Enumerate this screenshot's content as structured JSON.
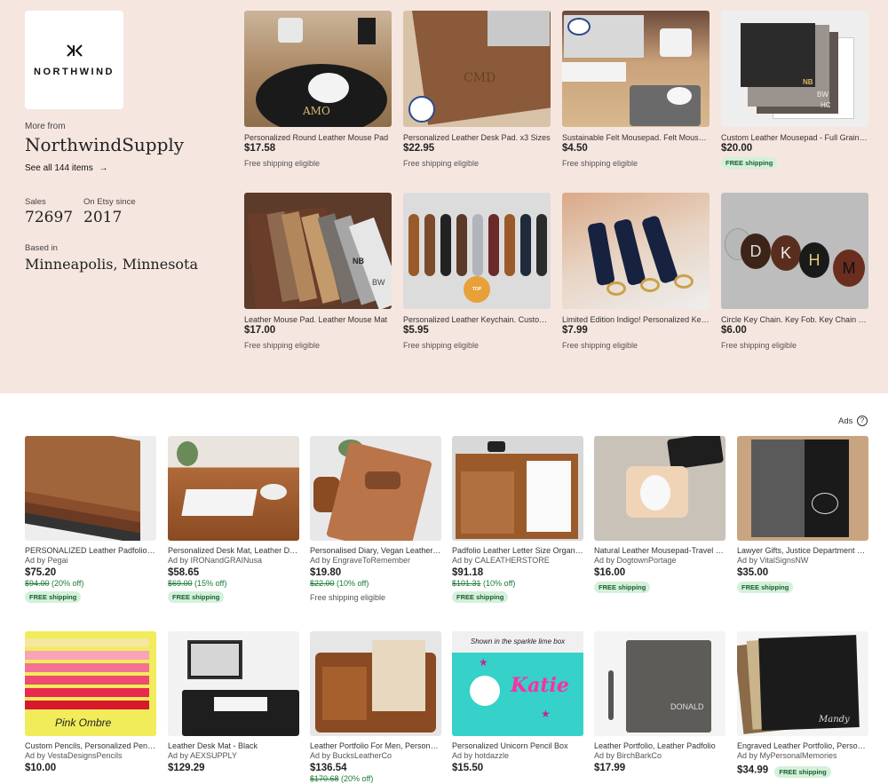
{
  "shop": {
    "logo_text": "NORTHWIND",
    "more_from": "More from",
    "name": "NorthwindSupply",
    "see_all": "See all 144 items",
    "sales_label": "Sales",
    "sales_value": "72697",
    "since_label": "On Etsy since",
    "since_value": "2017",
    "based_label": "Based in",
    "location": "Minneapolis, Minnesota"
  },
  "shop_items": [
    {
      "title": "Personalized Round Leather Mouse Pad",
      "price": "$17.58",
      "shipping": "Free shipping eligible",
      "badge": ""
    },
    {
      "title": "Personalized Leather Desk Pad. x3 Sizes",
      "price": "$22.95",
      "shipping": "Free shipping eligible",
      "badge": ""
    },
    {
      "title": "Sustainable Felt Mousepad. Felt Mouse Pad",
      "price": "$4.50",
      "shipping": "Free shipping eligible",
      "badge": ""
    },
    {
      "title": "Custom Leather Mousepad - Full Grain Leather",
      "price": "$20.00",
      "shipping": "",
      "badge": "FREE shipping"
    },
    {
      "title": "Leather Mouse Pad. Leather Mouse Mat",
      "price": "$17.00",
      "shipping": "Free shipping eligible",
      "badge": ""
    },
    {
      "title": "Personalized Leather Keychain. Custom Keychain",
      "price": "$5.95",
      "shipping": "Free shipping eligible",
      "badge": ""
    },
    {
      "title": "Limited Edition Indigo! Personalized Keychain",
      "price": "$7.99",
      "shipping": "Free shipping eligible",
      "badge": ""
    },
    {
      "title": "Circle Key Chain. Key Fob. Key Chain Personalized",
      "price": "$6.00",
      "shipping": "Free shipping eligible",
      "badge": ""
    }
  ],
  "ads_label": "Ads",
  "ads_help": "?",
  "ads_row1": [
    {
      "title": "PERSONALIZED Leather Padfolio Organizer",
      "seller": "Ad by Pegai",
      "price": "$75.20",
      "orig": "$94.00",
      "discount": " (20% off)",
      "shipping": "",
      "badge": "FREE shipping"
    },
    {
      "title": "Personalized Desk Mat, Leather Desk Pad",
      "seller": "Ad by IRONandGRAINusa",
      "price": "$58.65",
      "orig": "$69.00",
      "discount": " (15% off)",
      "shipping": "",
      "badge": "FREE shipping"
    },
    {
      "title": "Personalised Diary, Vegan Leather Journal",
      "seller": "Ad by EngraveToRemember",
      "price": "$19.80",
      "orig": "$22.00",
      "discount": " (10% off)",
      "shipping": "Free shipping eligible",
      "badge": ""
    },
    {
      "title": "Padfolio Leather Letter Size Organizer",
      "seller": "Ad by CALEATHERSTORE",
      "price": "$91.18",
      "orig": "$101.31",
      "discount": " (10% off)",
      "shipping": "",
      "badge": "FREE shipping"
    },
    {
      "title": "Natural Leather Mousepad-Travel Mouse Pad",
      "seller": "Ad by DogtownPortage",
      "price": "$16.00",
      "orig": "",
      "discount": "",
      "shipping": "",
      "badge": "FREE shipping"
    },
    {
      "title": "Lawyer Gifts, Justice Department Padfolio",
      "seller": "Ad by VitalSignsNW",
      "price": "$35.00",
      "orig": "",
      "discount": "",
      "shipping": "",
      "badge": "FREE shipping"
    }
  ],
  "ads_row2": [
    {
      "title": "Custom Pencils, Personalized Pencils",
      "seller": "Ad by VestaDesignsPencils",
      "price": "$10.00",
      "orig": "",
      "discount": "",
      "badge": ""
    },
    {
      "title": "Leather Desk Mat - Black",
      "seller": "Ad by AEXSUPPLY",
      "price": "$129.29",
      "orig": "",
      "discount": "",
      "badge": ""
    },
    {
      "title": "Leather Portfolio For Men, Personalized",
      "seller": "Ad by BucksLeatherCo",
      "price": "$136.54",
      "orig": "$170.68",
      "discount": " (20% off)",
      "badge": ""
    },
    {
      "title": "Personalized Unicorn Pencil Box",
      "seller": "Ad by hotdazzle",
      "price": "$15.50",
      "orig": "",
      "discount": "",
      "badge": ""
    },
    {
      "title": "Leather Portfolio, Leather Padfolio",
      "seller": "Ad by BirchBarkCo",
      "price": "$17.99",
      "orig": "",
      "discount": "",
      "badge": ""
    },
    {
      "title": "Engraved Leather Portfolio, Personalized",
      "seller": "Ad by MyPersonalMemories",
      "price": "$34.99",
      "orig": "",
      "discount": "",
      "badge": "FREE shipping"
    }
  ],
  "image_text": {
    "amo": "AMO",
    "cmd": "CMD",
    "nb": "NB",
    "bw": "BW",
    "hc": "HC",
    "k": "K",
    "h": "H",
    "m": "M",
    "d": "D",
    "pink": "Pink Ombre",
    "katie": "Katie",
    "donald": "DONALD",
    "mandy": "Mandy",
    "sparkle": "Shown in the sparkle lime box",
    "top_seller": "TOP SELLER"
  }
}
